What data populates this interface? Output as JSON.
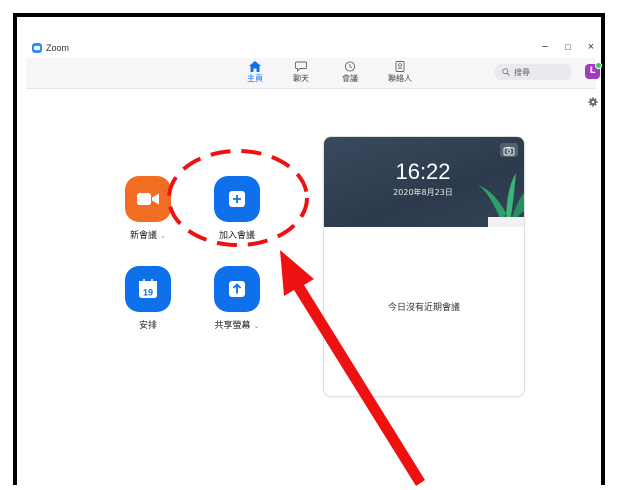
{
  "window": {
    "title": "Zoom",
    "controls": [
      "−",
      "□",
      "×"
    ]
  },
  "nav": {
    "tabs": [
      {
        "label": "主頁",
        "icon": "home-icon"
      },
      {
        "label": "聊天",
        "icon": "chat-icon"
      },
      {
        "label": "會議",
        "icon": "clock-icon"
      },
      {
        "label": "聯絡人",
        "icon": "contacts-icon"
      }
    ],
    "search_placeholder": "搜尋",
    "avatar_letter": "L"
  },
  "actions": [
    {
      "label": "新會議",
      "icon": "video-camera-icon",
      "dropdown": true
    },
    {
      "label": "加入會議",
      "icon": "plus-icon",
      "dropdown": false
    },
    {
      "label": "安排",
      "icon": "calendar-icon",
      "calendar_day": "19",
      "dropdown": false
    },
    {
      "label": "共享螢幕",
      "icon": "share-up-arrow-icon",
      "dropdown": true
    }
  ],
  "card": {
    "time": "16:22",
    "date": "2020年8月23日",
    "empty_message": "今日沒有近期會議"
  },
  "colors": {
    "accent_blue": "#0e71eb",
    "new_meeting_orange": "#f26d21",
    "annotation_red": "#ee1111"
  }
}
